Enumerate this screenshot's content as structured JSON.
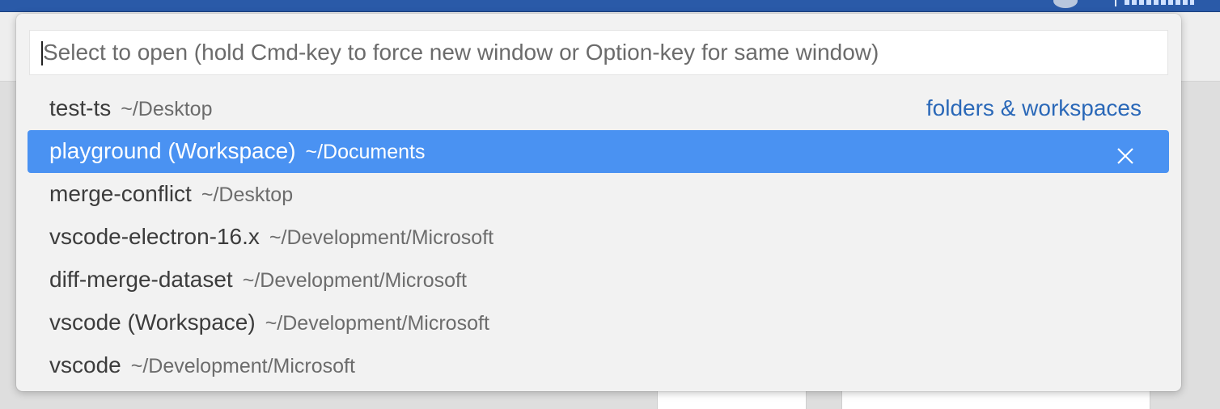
{
  "quick_open": {
    "placeholder": "Select to open (hold Cmd-key to force new window or Option-key for same window)",
    "group_label": "folders & workspaces",
    "items": [
      {
        "name": "test-ts",
        "path": "~/Desktop"
      },
      {
        "name": "playground (Workspace)",
        "path": "~/Documents"
      },
      {
        "name": "merge-conflict",
        "path": "~/Desktop"
      },
      {
        "name": "vscode-electron-16.x",
        "path": "~/Development/Microsoft"
      },
      {
        "name": "diff-merge-dataset",
        "path": "~/Development/Microsoft"
      },
      {
        "name": "vscode (Workspace)",
        "path": "~/Development/Microsoft"
      },
      {
        "name": "vscode",
        "path": "~/Development/Microsoft"
      }
    ],
    "selected_index": 1,
    "icons": {
      "remove": "close-icon"
    }
  },
  "colors": {
    "selection": "#4a92f2",
    "group_label": "#2a68b8",
    "title_bar": "#2a5aa8"
  }
}
